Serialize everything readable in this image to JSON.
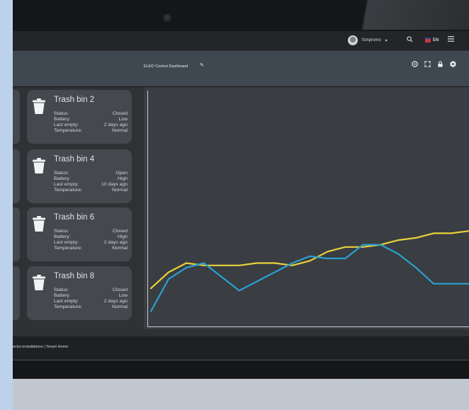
{
  "topbar": {
    "user_name": "fsmpromo",
    "user_caret": "▾",
    "language": "EN"
  },
  "dashboard": {
    "title": "ELKO Control Dashboard"
  },
  "bins": [
    {
      "title": "Trash bin 2",
      "status_label": "Status:",
      "status": "Closed",
      "battery_label": "Battery:",
      "battery": "Low",
      "last_empty_label": "Last empty:",
      "last_empty": "2 days ago",
      "temperature_label": "Temperature:",
      "temperature": "Normal"
    },
    {
      "title": "Trash bin 4",
      "status_label": "Status:",
      "status": "Open",
      "battery_label": "Battery:",
      "battery": "High",
      "last_empty_label": "Last empty:",
      "last_empty": "10 days ago",
      "temperature_label": "Temperature:",
      "temperature": "Normal"
    },
    {
      "title": "Trash bin 6",
      "status_label": "Status:",
      "status": "Closed",
      "battery_label": "Battery:",
      "battery": "High",
      "last_empty_label": "Last empty:",
      "last_empty": "2 days ago",
      "temperature_label": "Temperature:",
      "temperature": "Normal"
    },
    {
      "title": "Trash bin 8",
      "status_label": "Status:",
      "status": "Closed",
      "battery_label": "Battery:",
      "battery": "Low",
      "last_empty_label": "Last empty:",
      "last_empty": "2 days ago",
      "temperature_label": "Temperature:",
      "temperature": "Normal"
    }
  ],
  "footer": {
    "text": "ectro-installations | Smart Home"
  },
  "colors": {
    "series_yellow": "#e6d23a",
    "series_blue": "#2aa0cf"
  },
  "chart_data": {
    "type": "line",
    "title": "",
    "xlabel": "",
    "ylabel": "",
    "x": [
      0,
      1,
      2,
      3,
      4,
      5,
      6,
      7,
      8,
      9,
      10,
      11,
      12,
      13,
      14,
      15,
      16,
      17,
      18
    ],
    "ylim": [
      0,
      100
    ],
    "grid": false,
    "series": [
      {
        "color": "#e6d23a",
        "values": [
          16,
          23,
          27,
          26,
          26,
          26,
          27,
          27,
          26,
          28,
          32,
          34,
          34,
          35,
          37,
          38,
          40,
          40,
          41
        ]
      },
      {
        "color": "#2aa0cf",
        "values": [
          6,
          20,
          25,
          27,
          21,
          15,
          19,
          23,
          27,
          30,
          29,
          29,
          35,
          35,
          31,
          25,
          18,
          18,
          18
        ]
      }
    ]
  }
}
